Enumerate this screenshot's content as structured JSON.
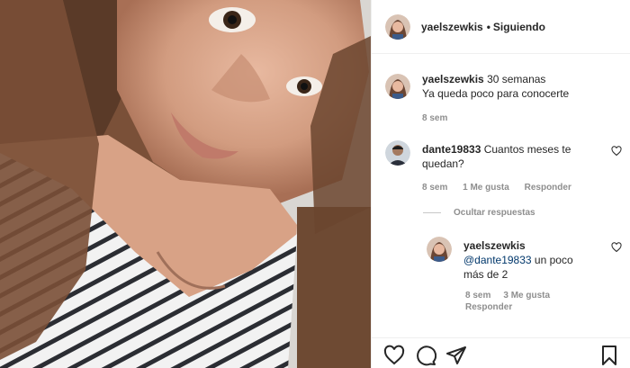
{
  "post": {
    "username": "yaelszewkis",
    "separator": "•",
    "follow_status": "Siguiendo"
  },
  "caption": {
    "username": "yaelszewkis",
    "text_line1": "30 semanas ",
    "text_line2": "Ya queda poco para conocerte ",
    "time": "8 sem"
  },
  "comments": [
    {
      "username": "dante19833",
      "text": "Cuantos meses te quedan?",
      "time": "8 sem",
      "likes": "1 Me gusta",
      "reply": "Responder"
    }
  ],
  "replies_toggle": "Ocultar respuestas",
  "replies": [
    {
      "username": "yaelszewkis",
      "mention": "@dante19833",
      "text": " un poco más de 2 ",
      "time": "8 sem",
      "likes": "3 Me gusta",
      "reply": "Responder"
    }
  ],
  "icons": {
    "like": "heart-outline-icon",
    "comment": "speech-bubble-icon",
    "share": "paper-plane-icon",
    "save": "bookmark-icon"
  },
  "colors": {
    "text": "#262626",
    "muted": "#8e8e8e",
    "mention": "#00376b",
    "border": "#efefef"
  }
}
